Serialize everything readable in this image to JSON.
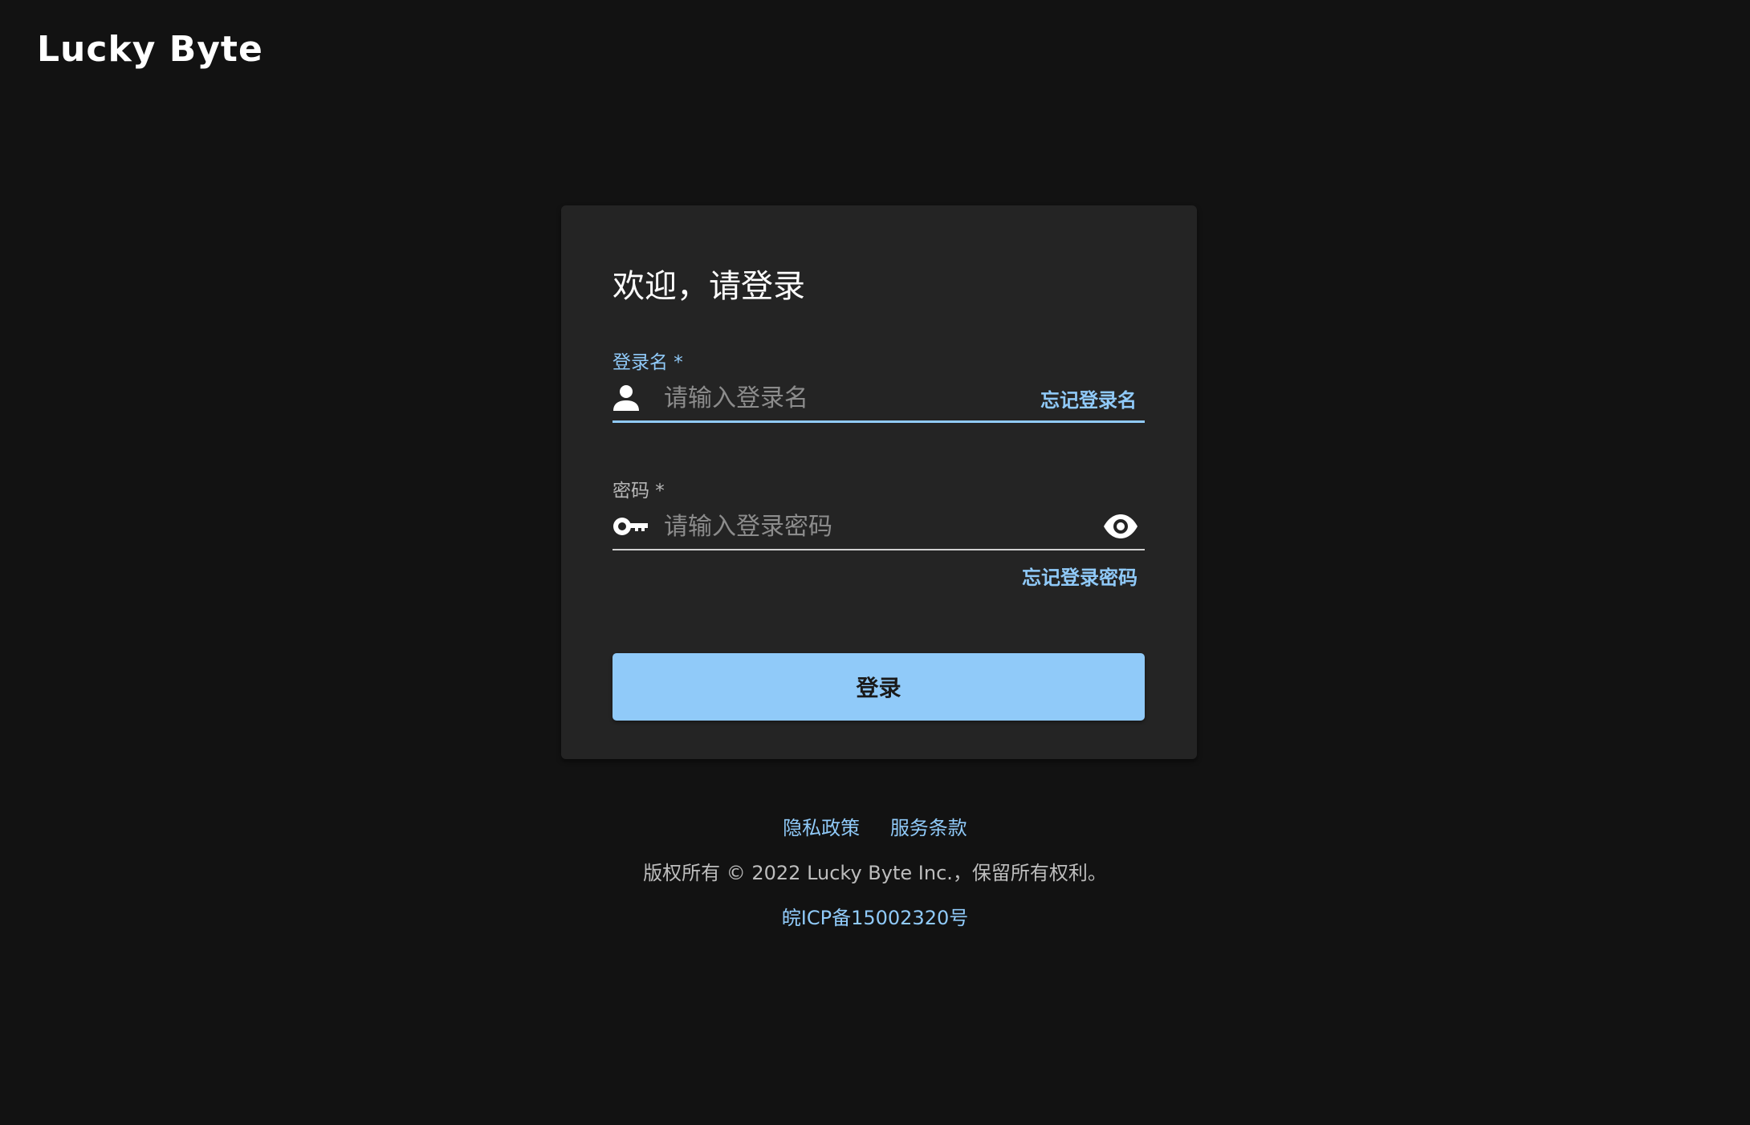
{
  "brand": {
    "logo_text": "Lucky Byte"
  },
  "login_card": {
    "title": "欢迎，请登录",
    "username": {
      "label": "登录名 *",
      "placeholder": "请输入登录名",
      "value": "",
      "icon": "person-icon",
      "forgot_label": "忘记登录名"
    },
    "password": {
      "label": "密码 *",
      "placeholder": "请输入登录密码",
      "value": "",
      "icon": "key-icon",
      "toggle_icon": "eye-icon",
      "forgot_label": "忘记登录密码"
    },
    "submit_label": "登录"
  },
  "footer": {
    "links": [
      "隐私政策",
      "服务条款"
    ],
    "copyright": "版权所有 © 2022 Lucky Byte Inc.，保留所有权利。",
    "icp": "皖ICP备15002320号"
  },
  "colors": {
    "background": "#121212",
    "card": "#242424",
    "accent": "#90caf9"
  }
}
